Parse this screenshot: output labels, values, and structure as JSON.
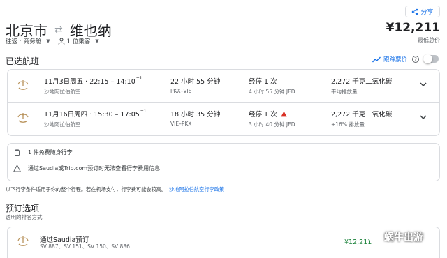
{
  "header": {
    "share_label": "分享",
    "origin": "北京市",
    "destination": "维也纳",
    "trip_type": "往返",
    "cabin": "商务舱",
    "passengers": "1 位乘客",
    "total_price": "¥12,211",
    "price_note": "最低总价"
  },
  "selected": {
    "title": "已选航班",
    "track_label": "跟踪票价"
  },
  "flights": [
    {
      "date_time": "11月3日周五 · 22:15 – 14:10",
      "day_offset": "+1",
      "airline": "沙地阿拉伯航空",
      "duration": "22 小时 55 分钟",
      "route": "PKX–VIE",
      "stops": "经停 1 次",
      "layover": "4 小时 55 分钟 JED",
      "co2": "2,272 千克二氧化碳",
      "co2_note": "平均排放量"
    },
    {
      "date_time": "11月16日周四 · 15:30 – 17:05",
      "day_offset": "+1",
      "airline": "沙地阿拉伯航空",
      "duration": "18 小时 35 分钟",
      "route": "VIE–PKX",
      "stops": "经停 1 次",
      "layover": "3 小时 40 分钟 JED",
      "co2": "2,272 千克二氧化碳",
      "co2_note": "+16% 排放量"
    }
  ],
  "baggage": {
    "carry_on": "1 件免费随身行李",
    "notice": "通过Saudia或Trip.com预订时无法查看行李费用信息",
    "footnote": "以下行李条件适用于你的整个行程。若在机场支付，行李费可能会较高。",
    "policy_link": "沙地阿拉伯航空行李政策"
  },
  "booking": {
    "title": "预订选项",
    "subtitle": "透明的排名方式",
    "options": [
      {
        "name": "通过Saudia预订",
        "flights": "SV 887、SV 151、SV 150、SV 886",
        "price": "¥12,211"
      }
    ]
  },
  "watermark": {
    "text": "蜗牛出游"
  },
  "colors": {
    "accent": "#1a73e8",
    "price_green": "#188038",
    "warning": "#d93025",
    "saudia_gold": "#b8925a",
    "border": "#dadce0"
  }
}
